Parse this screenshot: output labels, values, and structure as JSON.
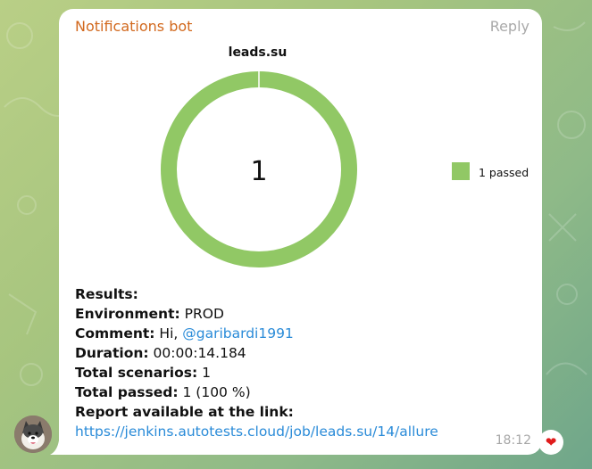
{
  "message": {
    "sender": "Notifications bot",
    "reply_label": "Reply",
    "time": "18:12",
    "reaction": "❤"
  },
  "chart_data": {
    "type": "pie",
    "title": "leads.su",
    "categories": [
      "passed"
    ],
    "values": [
      1
    ],
    "center_label": "1",
    "legend": [
      {
        "label": "1 passed",
        "color": "#91c865"
      }
    ],
    "legend_placement": "right",
    "colors": {
      "passed": "#91c865"
    }
  },
  "results": {
    "heading": "Results:",
    "environment_label": "Environment:",
    "environment_value": "PROD",
    "comment_label": "Comment:",
    "comment_text": "Hi,",
    "comment_mention": "@garibardi1991",
    "duration_label": "Duration:",
    "duration_value": "00:00:14.184",
    "scenarios_label": "Total scenarios:",
    "scenarios_value": "1",
    "passed_label": "Total passed:",
    "passed_value": "1 (100 %)",
    "report_label": "Report available at the link:",
    "report_url": "https://jenkins.autotests.cloud/job/leads.su/14/allure"
  },
  "colors": {
    "sender": "#d2691e",
    "link": "#2a8bd8",
    "chart_green": "#91c865"
  }
}
